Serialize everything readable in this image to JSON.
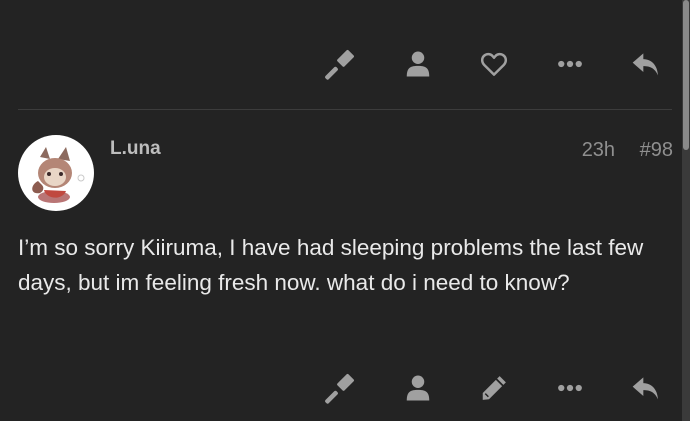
{
  "top_actions": [
    {
      "name": "flag-button",
      "icon": "gavel-icon"
    },
    {
      "name": "user-button",
      "icon": "user-icon"
    },
    {
      "name": "like-button",
      "icon": "heart-outline-icon"
    },
    {
      "name": "more-button",
      "icon": "ellipsis-icon"
    },
    {
      "name": "reply-button",
      "icon": "reply-icon"
    }
  ],
  "post": {
    "username": "L.una",
    "time": "23h",
    "post_number": "#98",
    "body": "I’m so sorry Kiiruma, I have had sleeping problems the last few days, but im feeling fresh now. what do i need to know?"
  },
  "bottom_actions": [
    {
      "name": "flag-button",
      "icon": "gavel-icon"
    },
    {
      "name": "user-button",
      "icon": "user-icon"
    },
    {
      "name": "edit-button",
      "icon": "pencil-icon"
    },
    {
      "name": "more-button",
      "icon": "ellipsis-icon"
    },
    {
      "name": "reply-button",
      "icon": "reply-icon"
    }
  ],
  "colors": {
    "background": "#232323",
    "icon": "#a0a0a0",
    "username": "#bdbdbd",
    "meta": "#8f8f8f",
    "body_text": "#e9e9e9"
  }
}
